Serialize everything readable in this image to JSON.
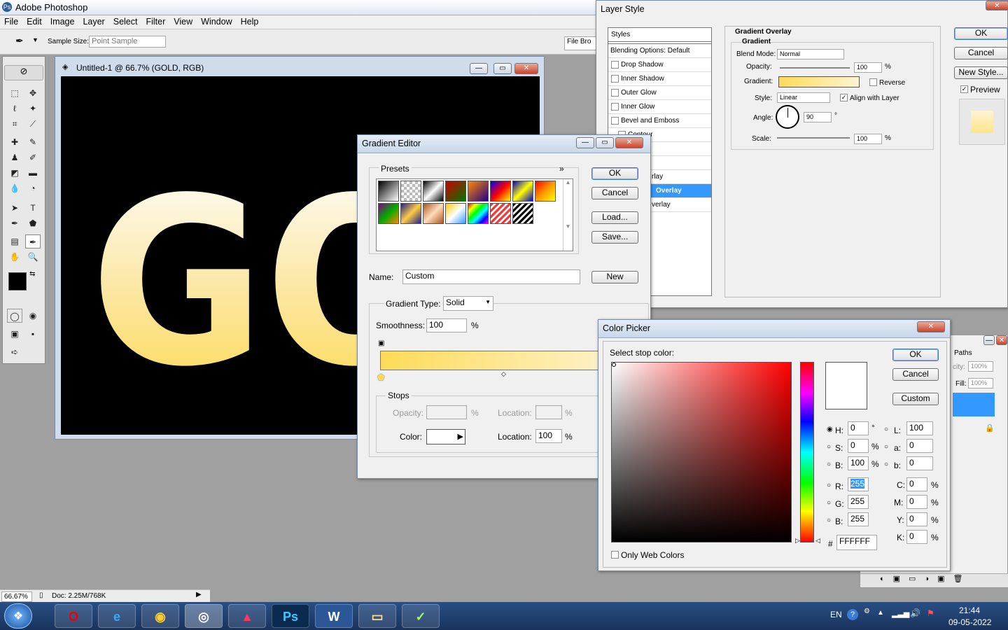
{
  "app": {
    "title": "Adobe Photoshop"
  },
  "menu": [
    "File",
    "Edit",
    "Image",
    "Layer",
    "Select",
    "Filter",
    "View",
    "Window",
    "Help"
  ],
  "options": {
    "sample_size_label": "Sample Size:",
    "sample_size_value": "Point Sample",
    "file_browser": "File Bro"
  },
  "document": {
    "title": "Untitled-1 @ 66.7% (GOLD, RGB)",
    "text": "GOL"
  },
  "status": {
    "zoom": "66.67%",
    "doc": "Doc: 2.25M/768K"
  },
  "layer_style": {
    "title": "Layer Style",
    "styles_header": "Styles",
    "items": [
      "Blending Options: Default",
      "Drop Shadow",
      "Inner Shadow",
      "Outer Glow",
      "Inner Glow",
      "Bevel and Emboss",
      "Contour",
      "rlay",
      "Overlay",
      "verlay"
    ],
    "section": "Gradient Overlay",
    "sub": "Gradient",
    "blend_mode_label": "Blend Mode:",
    "blend_mode": "Normal",
    "opacity_label": "Opacity:",
    "opacity": "100",
    "pct": "%",
    "gradient_label": "Gradient:",
    "reverse": "Reverse",
    "style_label": "Style:",
    "style": "Linear",
    "align": "Align with Layer",
    "angle_label": "Angle:",
    "angle": "90",
    "deg": "°",
    "scale_label": "Scale:",
    "scale": "100",
    "ok": "OK",
    "cancel": "Cancel",
    "new_style": "New Style...",
    "preview": "Preview"
  },
  "gradient_editor": {
    "title": "Gradient Editor",
    "presets": "Presets",
    "ok": "OK",
    "cancel": "Cancel",
    "load": "Load...",
    "save": "Save...",
    "name_label": "Name:",
    "name": "Custom",
    "new": "New",
    "type_label": "Gradient Type:",
    "type": "Solid",
    "smooth_label": "Smoothness:",
    "smooth": "100",
    "pct": "%",
    "stops": "Stops",
    "opacity_label": "Opacity:",
    "location_label": "Location:",
    "color_label": "Color:",
    "location": "100"
  },
  "color_picker": {
    "title": "Color Picker",
    "prompt": "Select stop color:",
    "ok": "OK",
    "cancel": "Cancel",
    "custom": "Custom",
    "H": "0",
    "S": "0",
    "B": "100",
    "R": "255",
    "G": "255",
    "Bv": "255",
    "L": "100",
    "a": "0",
    "b": "0",
    "C": "0",
    "M": "0",
    "Y": "0",
    "K": "0",
    "hex": "FFFFFF",
    "web": "Only Web Colors",
    "labels": {
      "H": "H:",
      "S": "S:",
      "B": "B:",
      "R": "R:",
      "G": "G:",
      "Bb": "B:",
      "L": "L:",
      "a": "a:",
      "b": "b:",
      "C": "C:",
      "M": "M:",
      "Y": "Y:",
      "K": "K:",
      "hash": "#",
      "deg": "°",
      "pct": "%"
    }
  },
  "layers": {
    "paths": "Paths",
    "opacity_label": "city:",
    "opacity": "100%",
    "fill_label": "Fill:",
    "fill": "100%"
  },
  "tray": {
    "lang": "EN",
    "time": "21:44",
    "date": "09-05-2022"
  },
  "colors": {
    "gold": "#fddb58",
    "accent": "#3399ff"
  }
}
